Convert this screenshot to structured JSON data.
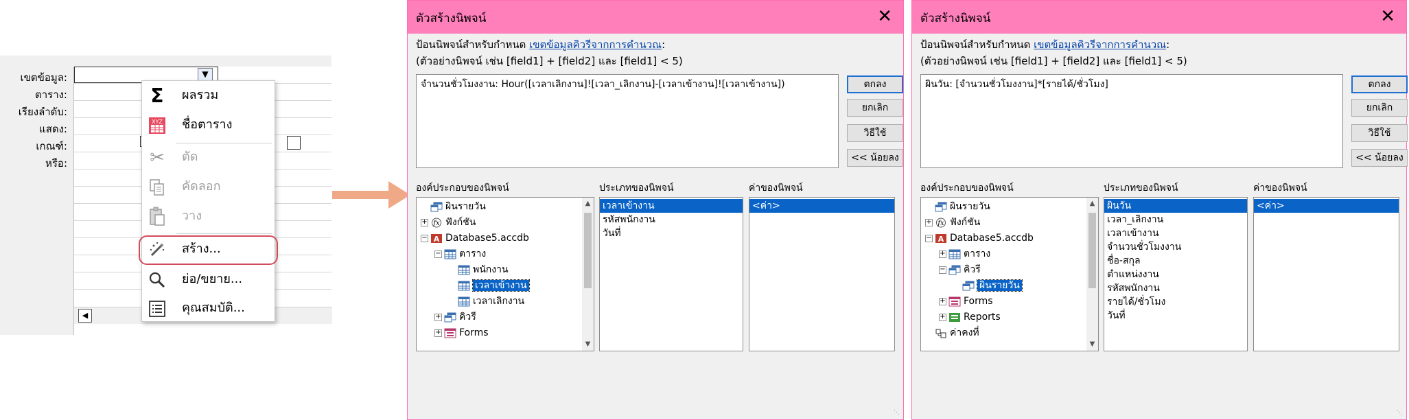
{
  "query_grid": {
    "row_labels": [
      "เขตข้อมูล:",
      "ตาราง:",
      "เรียงลำดับ:",
      "แสดง:",
      "เกณฑ์:",
      "หรือ:"
    ]
  },
  "context_menu": {
    "items": [
      {
        "label": "ผลรวม",
        "icon": "sigma-icon",
        "disabled": false
      },
      {
        "label": "ชื่อตาราง",
        "icon": "table-names-icon",
        "disabled": false
      },
      {
        "label": "ตัด",
        "icon": "scissors-icon",
        "disabled": true
      },
      {
        "label": "คัดลอก",
        "icon": "copy-icon",
        "disabled": true
      },
      {
        "label": "วาง",
        "icon": "paste-icon",
        "disabled": true
      },
      {
        "label": "สร้าง...",
        "icon": "builder-wand-icon",
        "disabled": false,
        "highlighted": true
      },
      {
        "label": "ย่อ/ขยาย...",
        "icon": "zoom-icon",
        "disabled": false
      },
      {
        "label": "คุณสมบัติ...",
        "icon": "properties-icon",
        "disabled": false
      }
    ]
  },
  "accent_colors": {
    "titlebar": "#ff7fbb",
    "highlight_ring": "#d24a5c",
    "arrow": "#f0a987",
    "selection": "#0a64c8"
  },
  "dialogs": [
    {
      "title": "ตัวสร้างนิพจน์",
      "instruction_prefix": "ป้อนนิพจน์สำหรับกำหนด ",
      "instruction_link": "เขตข้อมูลคิวรีจากการคำนวณ",
      "instruction_suffix": ":",
      "example": "(ตัวอย่างนิพจน์ เช่น [field1] + [field2] และ [field1] < 5)",
      "expression": "จำนวนชั่วโมงงาน: Hour([เวลาเลิกงาน]![เวลา_เลิกงาน]-[เวลาเข้างาน]![เวลาเข้างาน])",
      "buttons": {
        "ok": "ตกลง",
        "cancel": "ยกเลิก",
        "help": "วิธีใช้",
        "less": "<< น้อยลง"
      },
      "elements_label": "องค์ประกอบของนิพจน์",
      "categories_label": "ประเภทของนิพจน์",
      "values_label": "ค่าของนิพจน์",
      "tree": [
        {
          "text": "ผินรายวัน",
          "level": 0,
          "expander": "",
          "icon": "query-icon",
          "selected": false
        },
        {
          "text": "ฟังก์ชัน",
          "level": 0,
          "expander": "+",
          "icon": "function-icon",
          "selected": false
        },
        {
          "text": "Database5.accdb",
          "level": 0,
          "expander": "−",
          "icon": "access-db-icon",
          "selected": false
        },
        {
          "text": "ตาราง",
          "level": 1,
          "expander": "−",
          "icon": "table-icon",
          "selected": false
        },
        {
          "text": "พนักงาน",
          "level": 2,
          "expander": "",
          "icon": "table-icon",
          "selected": false
        },
        {
          "text": "เวลาเข้างาน",
          "level": 2,
          "expander": "",
          "icon": "table-icon",
          "selected": true
        },
        {
          "text": "เวลาเลิกงาน",
          "level": 2,
          "expander": "",
          "icon": "table-icon",
          "selected": false
        },
        {
          "text": "คิวรี",
          "level": 1,
          "expander": "+",
          "icon": "query-icon",
          "selected": false
        },
        {
          "text": "Forms",
          "level": 1,
          "expander": "+",
          "icon": "form-icon",
          "selected": false
        }
      ],
      "categories": [
        {
          "text": "เวลาเข้างาน",
          "selected": true
        },
        {
          "text": "รหัสพนักงาน",
          "selected": false
        },
        {
          "text": "วันที่",
          "selected": false
        }
      ],
      "values": [
        {
          "text": "<ค่า>",
          "selected": true
        }
      ]
    },
    {
      "title": "ตัวสร้างนิพจน์",
      "instruction_prefix": "ป้อนนิพจน์สำหรับกำหนด ",
      "instruction_link": "เขตข้อมูลคิวรีจากการคำนวณ",
      "instruction_suffix": ":",
      "example": "(ตัวอย่างนิพจน์ เช่น [field1] + [field2] และ [field1] < 5)",
      "expression": "ผินวัน: [จำนวนชั่วโมงงาน]*[รายได้/ชั่วโมง]",
      "buttons": {
        "ok": "ตกลง",
        "cancel": "ยกเลิก",
        "help": "วิธีใช้",
        "less": "<< น้อยลง"
      },
      "elements_label": "องค์ประกอบของนิพจน์",
      "categories_label": "ประเภทของนิพจน์",
      "values_label": "ค่าของนิพจน์",
      "tree": [
        {
          "text": "ผินรายวัน",
          "level": 0,
          "expander": "",
          "icon": "query-icon",
          "selected": false
        },
        {
          "text": "ฟังก์ชัน",
          "level": 0,
          "expander": "+",
          "icon": "function-icon",
          "selected": false
        },
        {
          "text": "Database5.accdb",
          "level": 0,
          "expander": "−",
          "icon": "access-db-icon",
          "selected": false
        },
        {
          "text": "ตาราง",
          "level": 1,
          "expander": "+",
          "icon": "table-icon",
          "selected": false
        },
        {
          "text": "คิวรี",
          "level": 1,
          "expander": "−",
          "icon": "query-icon",
          "selected": false
        },
        {
          "text": "ผินรายวัน",
          "level": 2,
          "expander": "",
          "icon": "query-icon",
          "selected": true
        },
        {
          "text": "Forms",
          "level": 1,
          "expander": "+",
          "icon": "form-icon",
          "selected": false
        },
        {
          "text": "Reports",
          "level": 1,
          "expander": "+",
          "icon": "report-icon",
          "selected": false
        },
        {
          "text": "ค่าคงที่",
          "level": 0,
          "expander": "",
          "icon": "constant-icon",
          "selected": false
        }
      ],
      "categories": [
        {
          "text": "ผินวัน",
          "selected": true
        },
        {
          "text": "เวลา_เลิกงาน",
          "selected": false
        },
        {
          "text": "เวลาเข้างาน",
          "selected": false
        },
        {
          "text": "จำนวนชั่วโมงงาน",
          "selected": false
        },
        {
          "text": "ชื่อ-สกุล",
          "selected": false
        },
        {
          "text": "ตำแหน่งงาน",
          "selected": false
        },
        {
          "text": "รหัสพนักงาน",
          "selected": false
        },
        {
          "text": "รายได้/ชั่วโมง",
          "selected": false
        },
        {
          "text": "วันที่",
          "selected": false
        }
      ],
      "values": [
        {
          "text": "<ค่า>",
          "selected": true
        }
      ]
    }
  ]
}
